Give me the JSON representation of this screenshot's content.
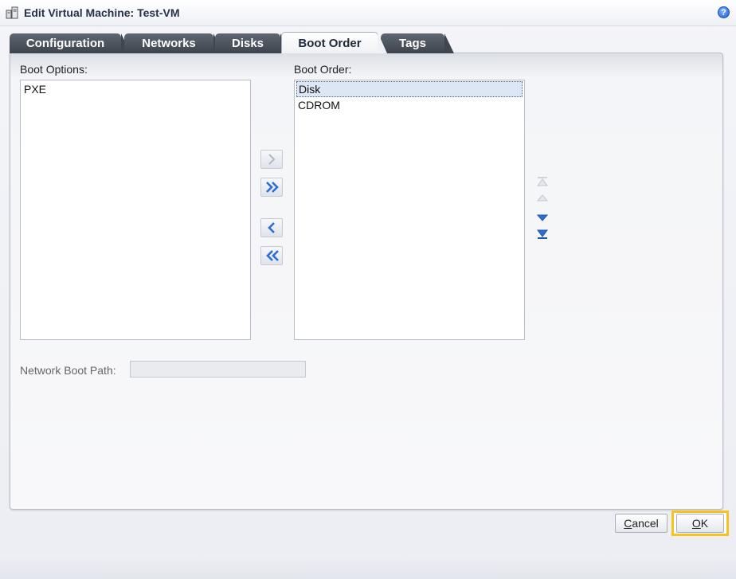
{
  "window": {
    "title": "Edit Virtual Machine: Test-VM",
    "help_glyph": "?"
  },
  "tabs": [
    {
      "label": "Configuration",
      "active": false
    },
    {
      "label": "Networks",
      "active": false
    },
    {
      "label": "Disks",
      "active": false
    },
    {
      "label": "Boot Order",
      "active": true
    },
    {
      "label": "Tags",
      "active": false
    }
  ],
  "boot_options": {
    "label": "Boot Options:",
    "items": [
      "PXE"
    ]
  },
  "boot_order": {
    "label": "Boot Order:",
    "items": [
      "Disk",
      "CDROM"
    ],
    "selected": "Disk"
  },
  "move_buttons": {
    "move_right": "chevron-right-icon",
    "move_all_right": "double-chevron-right-icon",
    "move_left": "chevron-left-icon",
    "move_all_left": "double-chevron-left-icon"
  },
  "order_buttons": {
    "move_top": "move-top-icon",
    "move_up": "move-up-icon",
    "move_down": "move-down-icon",
    "move_bottom": "move-bottom-icon"
  },
  "network_boot_path": {
    "label": "Network Boot Path:",
    "value": ""
  },
  "footer": {
    "cancel_prefix": "C",
    "cancel_rest": "ancel",
    "ok_prefix": "O",
    "ok_rest": "K"
  },
  "colors": {
    "accent_blue": "#2a6fd6",
    "highlight_frame": "#f7c21b",
    "tab_dark": "#4a515a"
  }
}
